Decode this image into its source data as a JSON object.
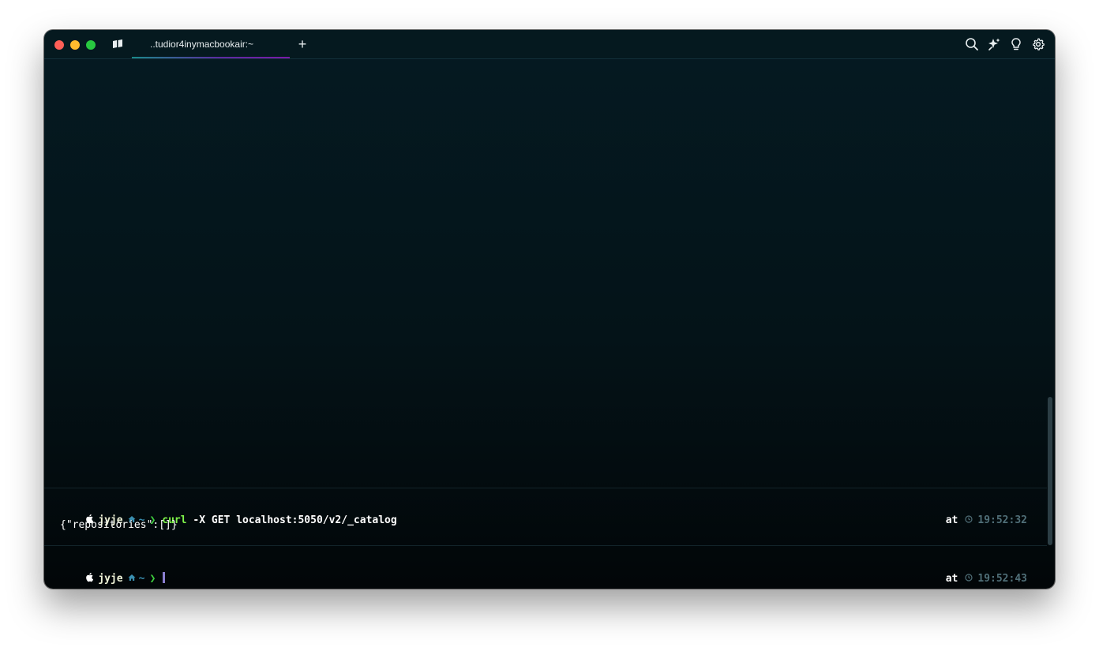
{
  "window": {
    "tab_title": "..tudior4inymacbookair:~",
    "new_tab_label": "+"
  },
  "toolbar_icons": [
    "search-icon",
    "ai-sparkle-icon",
    "lightbulb-icon",
    "settings-gear-icon"
  ],
  "blocks": [
    {
      "prompt": {
        "user": "jyje",
        "dir": "~",
        "chevron": "❯"
      },
      "command": "curl",
      "args": " -X GET localhost:5050/v2/_catalog",
      "output": "{\"repositories\":[]}",
      "at_label": "at",
      "time": "19:52:32"
    }
  ],
  "active_prompt": {
    "user": "jyje",
    "dir": "~",
    "chevron": "❯",
    "at_label": "at",
    "time": "19:52:43"
  },
  "colors": {
    "background_top": "#051a22",
    "background_bottom": "#020608",
    "command_green": "#7ef34a",
    "chevron_green": "#3ecf3e",
    "dir_blue": "#3a8fb0",
    "time_gray": "#506f78",
    "cursor_purple": "#8a7fd0"
  }
}
